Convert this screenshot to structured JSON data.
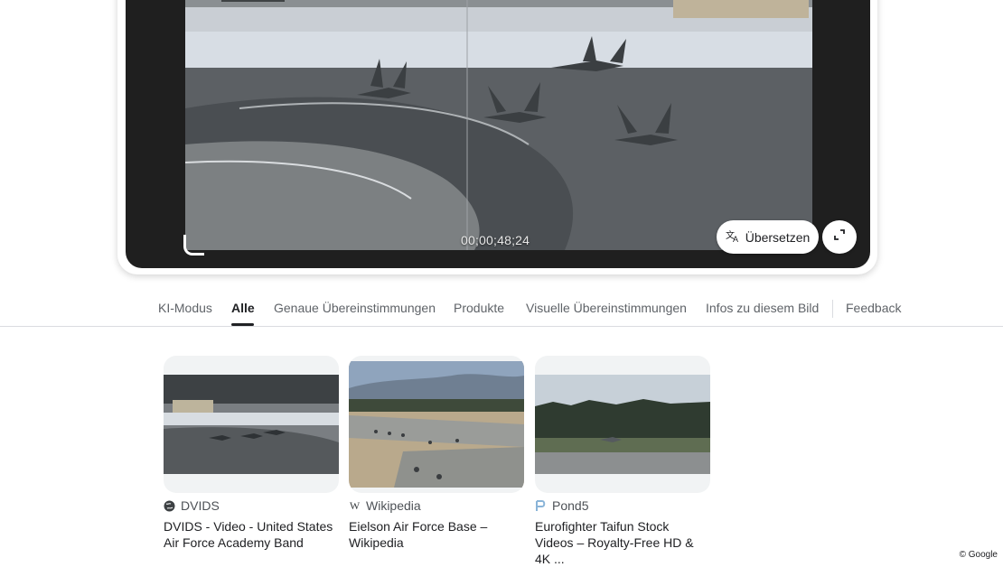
{
  "video": {
    "timecode": "00;00;48;24",
    "translate_label": "Übersetzen"
  },
  "tabs": [
    {
      "label": "KI-Modus"
    },
    {
      "label": "Alle"
    },
    {
      "label": "Genaue Übereinstimmungen"
    },
    {
      "label": "Produkte"
    },
    {
      "label": "Visuelle Übereinstimmungen"
    },
    {
      "label": "Infos zu diesem Bild"
    },
    {
      "label": "Feedback"
    }
  ],
  "active_tab": "Alle",
  "results": [
    {
      "source": "DVIDS",
      "icon": "globe-icon",
      "title": "DVIDS - Video - United States Air Force Academy Band"
    },
    {
      "source": "Wikipedia",
      "icon": "wikipedia-icon",
      "title": "Eielson Air Force Base – Wikipedia"
    },
    {
      "source": "Pond5",
      "icon": "pond5-icon",
      "title": "Eurofighter Taifun Stock Videos – Royalty-Free HD & 4K ..."
    }
  ],
  "footer": {
    "copyright": "© Google"
  }
}
